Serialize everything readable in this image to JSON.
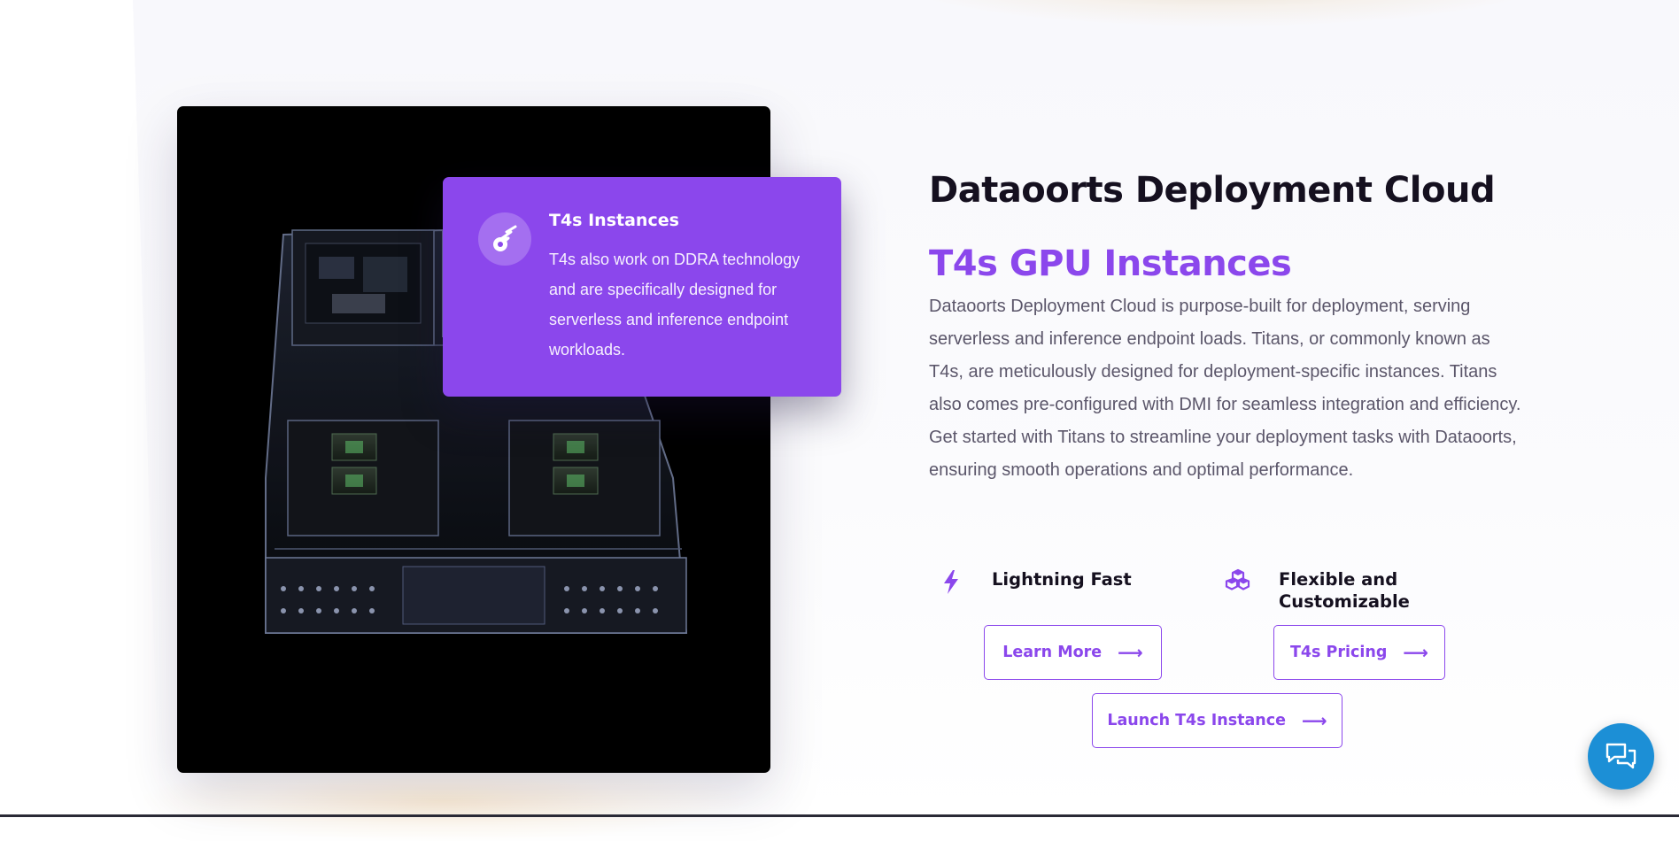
{
  "feature_card": {
    "title": "T4s Instances",
    "description": "T4s also work on DDRA technology and are specifically designed for serverless and inference endpoint workloads.",
    "icon": "comet-icon"
  },
  "main": {
    "heading": "Dataoorts Deployment Cloud",
    "subheading": "T4s GPU Instances",
    "body": "Dataoorts Deployment Cloud is purpose-built for deployment, serving serverless and inference endpoint loads. Titans, or commonly known as T4s, are meticulously designed for deployment-specific instances. Titans also comes pre-configured with DMI for seamless integration and efficiency. Get started with Titans to streamline your deployment tasks with Dataoorts, ensuring smooth operations and optimal performance."
  },
  "features": [
    {
      "label": "Lightning Fast",
      "icon": "lightning-bolt-icon"
    },
    {
      "label": "Flexible and Customizable",
      "icon": "cubes-icon"
    }
  ],
  "buttons": {
    "learn_more": "Learn More",
    "pricing": "T4s Pricing",
    "launch": "Launch T4s Instance",
    "arrow": "⟶"
  },
  "image": {
    "subject": "gpu-server-board-image"
  },
  "chat": {
    "icon": "chat-bubbles-icon"
  },
  "colors": {
    "accent": "#8b47ec",
    "heading": "#15101f",
    "body_text": "#5b566a",
    "chat_button": "#1c8fd6"
  }
}
